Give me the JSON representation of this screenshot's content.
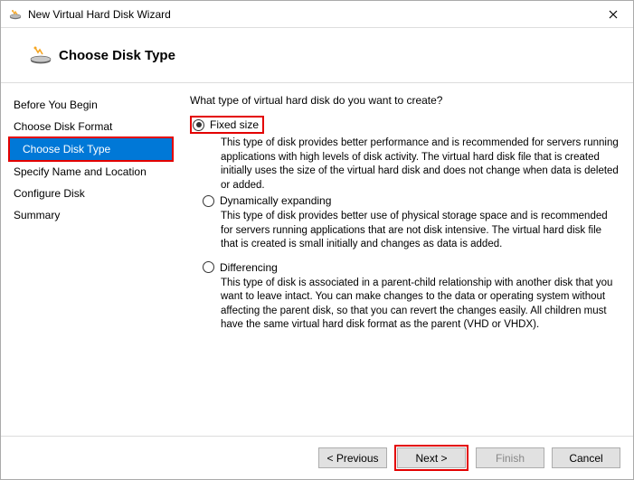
{
  "titlebar": {
    "title": "New Virtual Hard Disk Wizard"
  },
  "header": {
    "heading": "Choose Disk Type"
  },
  "sidebar": {
    "items": [
      {
        "label": "Before You Begin"
      },
      {
        "label": "Choose Disk Format"
      },
      {
        "label": "Choose Disk Type"
      },
      {
        "label": "Specify Name and Location"
      },
      {
        "label": "Configure Disk"
      },
      {
        "label": "Summary"
      }
    ],
    "selected_index": 2
  },
  "main": {
    "question": "What type of virtual hard disk do you want to create?",
    "options": [
      {
        "label": "Fixed size",
        "desc": "This type of disk provides better performance and is recommended for servers running applications with high levels of disk activity. The virtual hard disk file that is created initially uses the size of the virtual hard disk and does not change when data is deleted or added."
      },
      {
        "label": "Dynamically expanding",
        "desc": "This type of disk provides better use of physical storage space and is recommended for servers running applications that are not disk intensive. The virtual hard disk file that is created is small initially and changes as data is added."
      },
      {
        "label": "Differencing",
        "desc": "This type of disk is associated in a parent-child relationship with another disk that you want to leave intact. You can make changes to the data or operating system without affecting the parent disk, so that you can revert the changes easily. All children must have the same virtual hard disk format as the parent (VHD or VHDX)."
      }
    ],
    "selected_option": 0
  },
  "footer": {
    "previous": "< Previous",
    "next": "Next >",
    "finish": "Finish",
    "cancel": "Cancel"
  }
}
